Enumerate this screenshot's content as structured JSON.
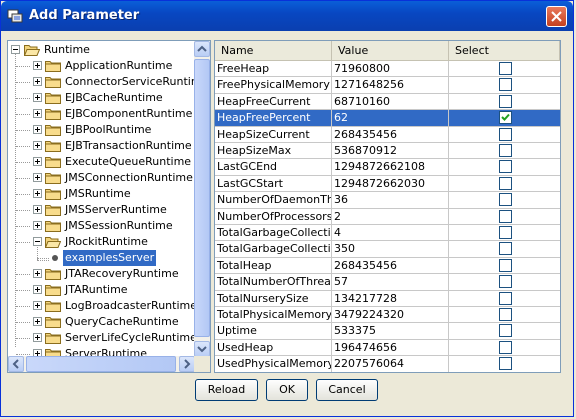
{
  "window": {
    "title": "Add Parameter"
  },
  "tree": {
    "root": "Runtime",
    "items": [
      {
        "label": "ApplicationRuntime"
      },
      {
        "label": "ConnectorServiceRuntime"
      },
      {
        "label": "EJBCacheRuntime"
      },
      {
        "label": "EJBComponentRuntime"
      },
      {
        "label": "EJBPoolRuntime"
      },
      {
        "label": "EJBTransactionRuntime"
      },
      {
        "label": "ExecuteQueueRuntime"
      },
      {
        "label": "JMSConnectionRuntime"
      },
      {
        "label": "JMSRuntime"
      },
      {
        "label": "JMSServerRuntime"
      },
      {
        "label": "JMSSessionRuntime"
      },
      {
        "label": "JRockitRuntime"
      },
      {
        "label": "examplesServer"
      },
      {
        "label": "JTARecoveryRuntime"
      },
      {
        "label": "JTARuntime"
      },
      {
        "label": "LogBroadcasterRuntime"
      },
      {
        "label": "QueryCacheRuntime"
      },
      {
        "label": "ServerLifeCycleRuntime"
      },
      {
        "label": "ServerRuntime"
      }
    ]
  },
  "table": {
    "headers": [
      "Name",
      "Value",
      "Select"
    ],
    "rows": [
      {
        "name": "FreeHeap",
        "value": "71960800",
        "checked": false
      },
      {
        "name": "FreePhysicalMemory",
        "value": "1271648256",
        "checked": false
      },
      {
        "name": "HeapFreeCurrent",
        "value": "68710160",
        "checked": false
      },
      {
        "name": "HeapFreePercent",
        "value": "62",
        "checked": true
      },
      {
        "name": "HeapSizeCurrent",
        "value": "268435456",
        "checked": false
      },
      {
        "name": "HeapSizeMax",
        "value": "536870912",
        "checked": false
      },
      {
        "name": "LastGCEnd",
        "value": "1294872662108",
        "checked": false
      },
      {
        "name": "LastGCStart",
        "value": "1294872662030",
        "checked": false
      },
      {
        "name": "NumberOfDaemonTh...",
        "value": "36",
        "checked": false
      },
      {
        "name": "NumberOfProcessors",
        "value": "2",
        "checked": false
      },
      {
        "name": "TotalGarbageCollecti...",
        "value": "4",
        "checked": false
      },
      {
        "name": "TotalGarbageCollecti...",
        "value": "350",
        "checked": false
      },
      {
        "name": "TotalHeap",
        "value": "268435456",
        "checked": false
      },
      {
        "name": "TotalNumberOfThreads",
        "value": "57",
        "checked": false
      },
      {
        "name": "TotalNurserySize",
        "value": "134217728",
        "checked": false
      },
      {
        "name": "TotalPhysicalMemory",
        "value": "3479224320",
        "checked": false
      },
      {
        "name": "Uptime",
        "value": "533375",
        "checked": false
      },
      {
        "name": "UsedHeap",
        "value": "196474656",
        "checked": false
      },
      {
        "name": "UsedPhysicalMemory",
        "value": "2207576064",
        "checked": false
      }
    ]
  },
  "buttons": {
    "reload": "Reload",
    "ok": "OK",
    "cancel": "Cancel"
  },
  "colors": {
    "selection": "#316ac5",
    "titlebar": "#0847c2",
    "close": "#c5401f"
  }
}
